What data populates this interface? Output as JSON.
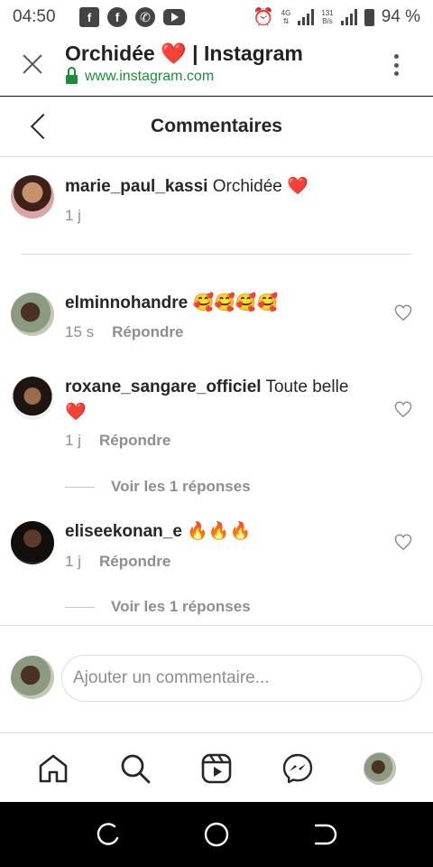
{
  "status_bar": {
    "time": "04:50",
    "network_label": "4G",
    "speed_value": "131",
    "speed_unit": "B/s",
    "battery": "94 %",
    "left_icons": [
      "facebook-square-icon",
      "facebook-icon",
      "whatsapp-icon",
      "youtube-icon"
    ],
    "right_icons": [
      "alarm-icon",
      "signal-icon",
      "signal-icon",
      "battery-icon"
    ]
  },
  "browser": {
    "title": "Orchidée ❤️ | Instagram",
    "url": "www.instagram.com",
    "close_icon": "close-icon",
    "lock_icon": "lock-icon",
    "menu_icon": "more-vert-icon"
  },
  "header": {
    "title": "Commentaires",
    "back_icon": "chevron-left-icon"
  },
  "caption": {
    "username": "marie_paul_kassi",
    "text": "Orchidée ❤️",
    "time": "1 j"
  },
  "comments": [
    {
      "username": "elminnohandre",
      "text": "🥰🥰🥰🥰",
      "time": "15 s",
      "reply_label": "Répondre",
      "view_replies": ""
    },
    {
      "username": "roxane_sangare_officiel",
      "text": "Toute belle",
      "text2": "❤️",
      "time": "1 j",
      "reply_label": "Répondre",
      "view_replies": "Voir les 1 réponses"
    },
    {
      "username": "eliseekonan_e",
      "text": "🔥🔥🔥",
      "time": "1 j",
      "reply_label": "Répondre",
      "view_replies": "Voir les 1 réponses"
    }
  ],
  "add_comment": {
    "placeholder": "Ajouter un commentaire..."
  },
  "nav": {
    "icons": [
      "home-icon",
      "search-icon",
      "reels-icon",
      "messenger-icon",
      "profile-avatar"
    ]
  },
  "system_nav": {
    "icons": [
      "recents-icon",
      "home-circle-icon",
      "back-icon"
    ]
  },
  "colors": {
    "url_green": "#1a8f3a",
    "text": "#262626",
    "muted": "#8e8e8e",
    "heart_red": "#e0245e"
  }
}
